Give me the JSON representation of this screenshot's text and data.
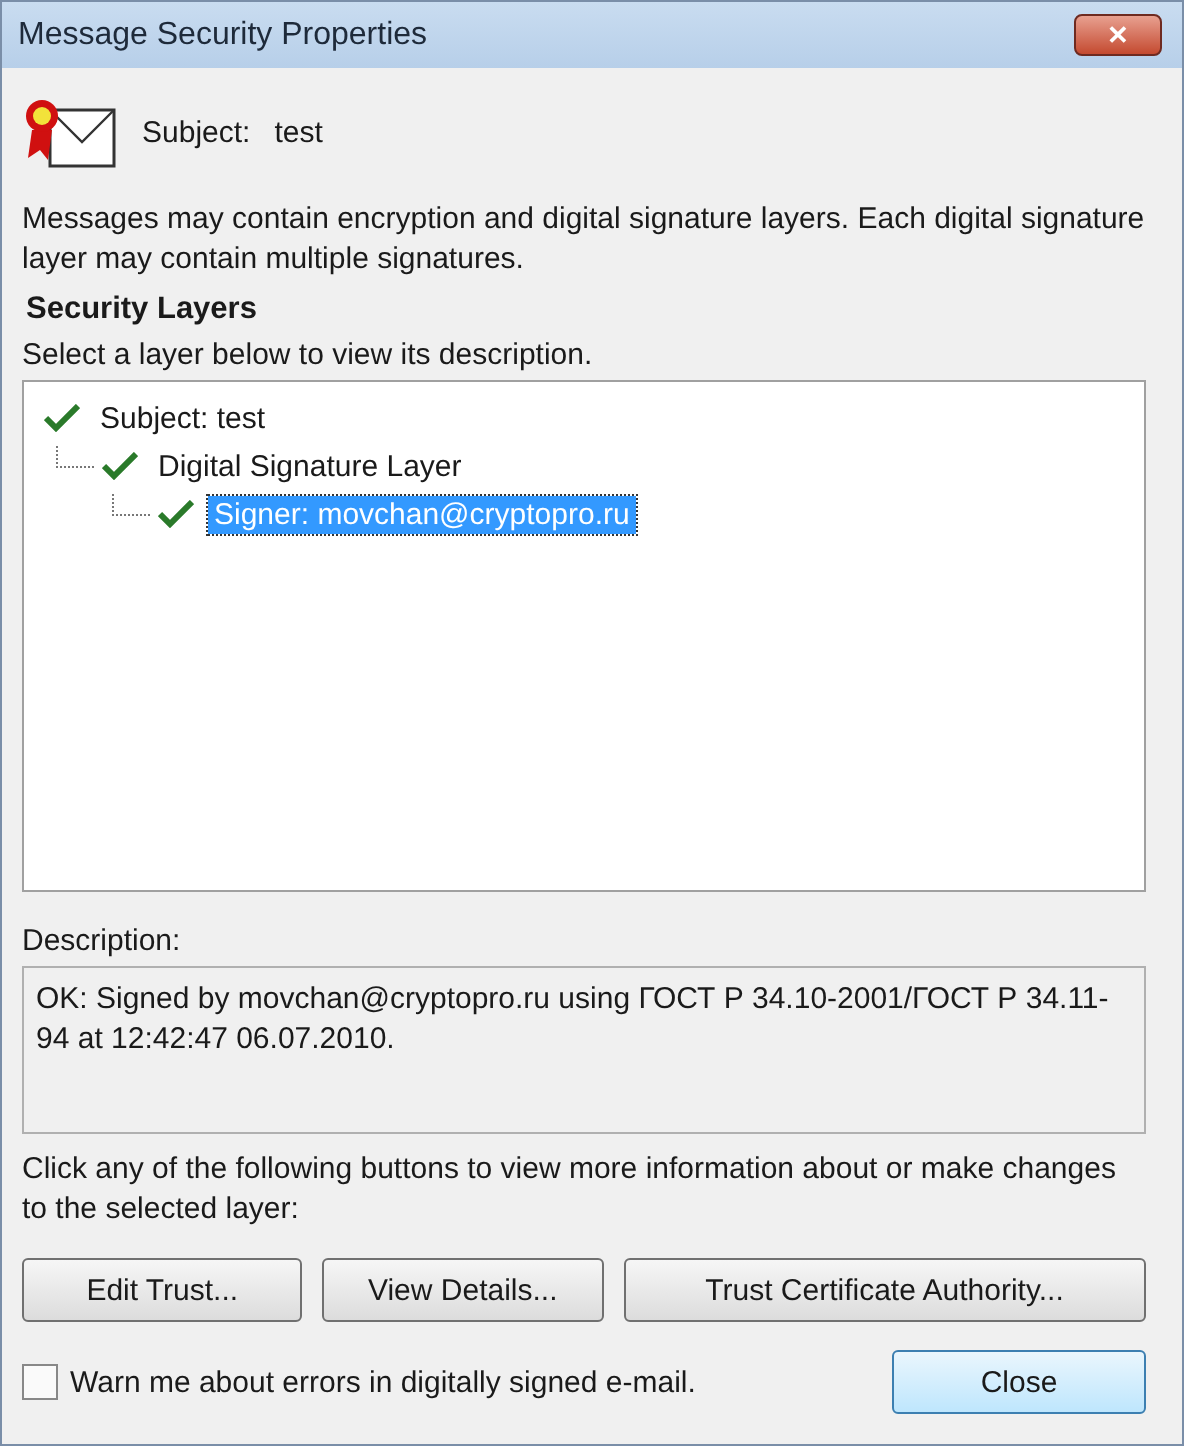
{
  "window": {
    "title": "Message Security Properties",
    "close_label": "✕"
  },
  "subject": {
    "label": "Subject:",
    "value": "test"
  },
  "intro": "Messages may contain encryption and digital signature layers. Each digital signature layer may contain multiple signatures.",
  "security_layers": {
    "heading": "Security Layers",
    "hint": "Select a layer below to view its description.",
    "tree": [
      {
        "label": "Subject: test",
        "valid": true,
        "selected": false,
        "children": [
          {
            "label": "Digital Signature Layer",
            "valid": true,
            "selected": false,
            "children": [
              {
                "label": "Signer: movchan@cryptopro.ru",
                "valid": true,
                "selected": true
              }
            ]
          }
        ]
      }
    ]
  },
  "description": {
    "label": "Description:",
    "text": "OK: Signed by movchan@cryptopro.ru using ГОСТ Р 34.10-2001/ГОСТ Р 34.11-94 at 12:42:47 06.07.2010."
  },
  "buttons_hint": "Click any of the following buttons to view more information about or make changes to the selected layer:",
  "layer_buttons": [
    "Edit Trust...",
    "View Details...",
    "Trust Certificate Authority..."
  ],
  "warn": {
    "label": "Warn me about errors in digitally signed e-mail.",
    "checked": false
  },
  "close_button": "Close"
}
